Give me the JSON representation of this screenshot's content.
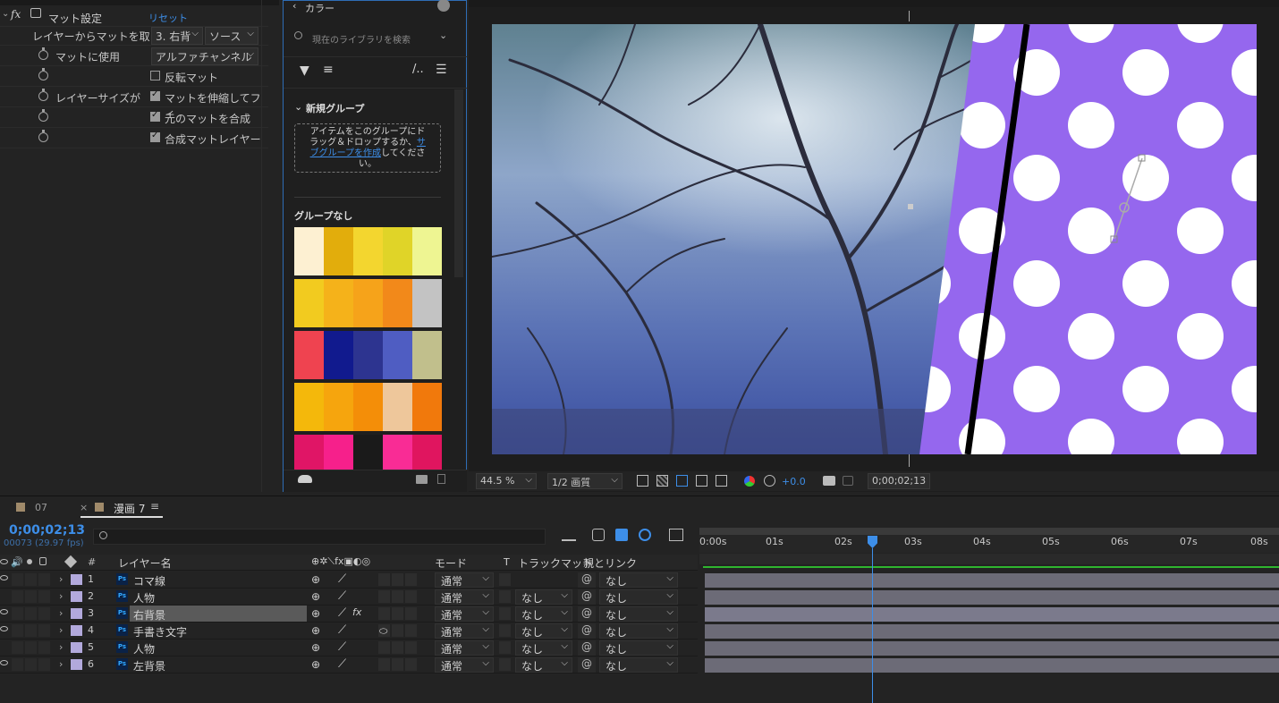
{
  "effect_controls": {
    "effect_name": "マット設定",
    "reset": "リセット",
    "rows": [
      {
        "label": "レイヤーからマットを取り",
        "value1": "3. 右背",
        "value2": "ソース"
      },
      {
        "label": "マットに使用",
        "value": "アルファチャンネル"
      },
      {
        "checkbox_label": "反転マット",
        "checked": false
      },
      {
        "label": "レイヤーサイズが",
        "checkbox_label": "マットを伸縮してフィ",
        "checked": true
      },
      {
        "checkbox_label": "元のマットを合成",
        "checked": true
      },
      {
        "checkbox_label": "合成マットレイヤー",
        "checked": true
      }
    ]
  },
  "color_panel": {
    "title": "カラー",
    "search_placeholder": "現在のライブラリを検索",
    "group_title": "新規グループ",
    "drop_text_1": "アイテムをこのグループにド",
    "drop_text_2": "ラッグ＆ドロップするか、",
    "drop_link_1": "サ",
    "drop_link_2": "ブグループを作成",
    "drop_text_3": "してくださ",
    "drop_text_4": "い。",
    "no_group": "グループなし",
    "swatches": [
      [
        "#fdf0d2",
        "#e2ad0c",
        "#f3d62f",
        "#e0d428",
        "#eef592"
      ],
      [
        "#f2cb1f",
        "#f5b21a",
        "#f6a31a",
        "#f2891a",
        "#c3c3c3"
      ],
      [
        "#ef4350",
        "#111a8e",
        "#2d3490",
        "#4f5dc2",
        "#c1bf8c"
      ],
      [
        "#f4b80b",
        "#f6a50d",
        "#f48e08",
        "#eec79b",
        "#f1790c"
      ],
      [
        "#e01566",
        "#f6208b",
        "#1a1a1a",
        "#f92c95",
        "#e0155f"
      ]
    ]
  },
  "viewer": {
    "zoom": "44.5 %",
    "quality": "1/2 画質",
    "exposure": "+0.0",
    "timecode": "0;00;02;13"
  },
  "timeline": {
    "tab_inactive": "07",
    "tab_active": "漫画 7",
    "current_time": "0;00;02;13",
    "frame_info": "00073 (29.97 fps)",
    "columns": {
      "name": "レイヤー名",
      "num": "#",
      "mode": "モード",
      "t": "T",
      "trackmatte": "トラックマット",
      "parent": "親とリンク"
    },
    "ruler": [
      "0:00s",
      "01s",
      "02s",
      "03s",
      "04s",
      "05s",
      "06s",
      "07s",
      "08s"
    ],
    "layers": [
      {
        "num": "1",
        "name": "コマ線",
        "mode": "通常",
        "trackmatte": "",
        "parent": "なし",
        "eye": true,
        "fx": false,
        "motion_blur": false
      },
      {
        "num": "2",
        "name": "人物",
        "mode": "通常",
        "trackmatte": "なし",
        "parent": "なし",
        "eye": false,
        "fx": false,
        "motion_blur": false
      },
      {
        "num": "3",
        "name": "右背景",
        "mode": "通常",
        "trackmatte": "なし",
        "parent": "なし",
        "eye": true,
        "fx": true,
        "motion_blur": false
      },
      {
        "num": "4",
        "name": "手書き文字",
        "mode": "通常",
        "trackmatte": "なし",
        "parent": "なし",
        "eye": true,
        "fx": false,
        "motion_blur": true
      },
      {
        "num": "5",
        "name": "人物",
        "mode": "通常",
        "trackmatte": "なし",
        "parent": "なし",
        "eye": false,
        "fx": false,
        "motion_blur": false
      },
      {
        "num": "6",
        "name": "左背景",
        "mode": "通常",
        "trackmatte": "なし",
        "parent": "なし",
        "eye": true,
        "fx": false,
        "motion_blur": false
      }
    ]
  }
}
